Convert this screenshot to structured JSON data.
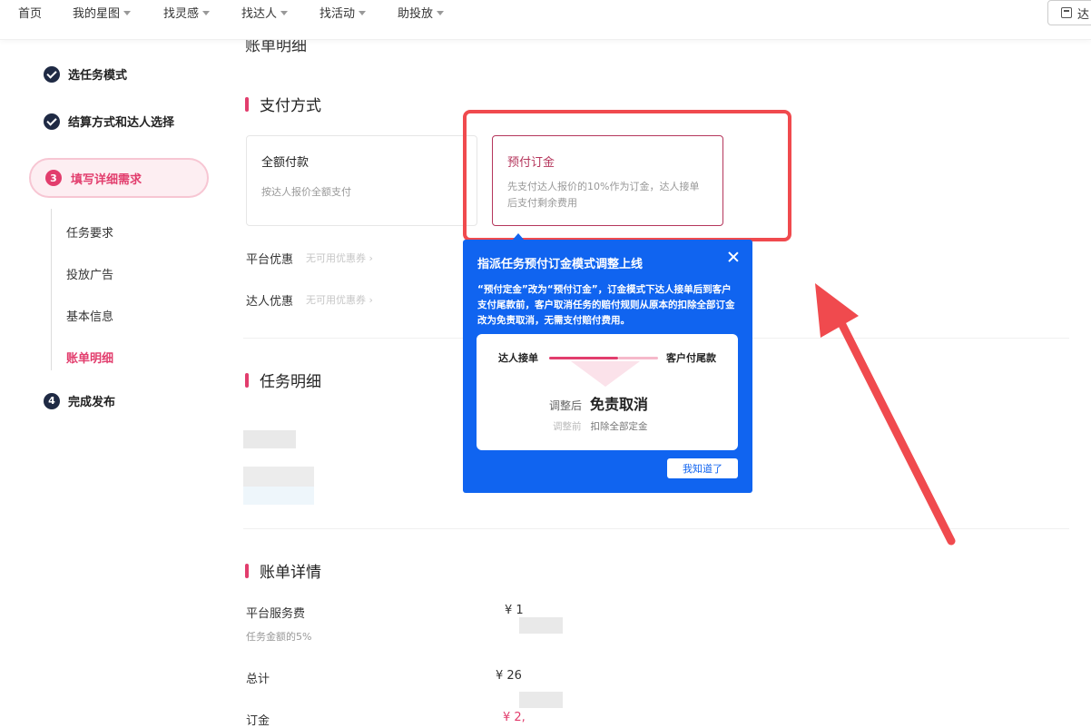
{
  "nav": {
    "items": [
      {
        "label": "首页",
        "dropdown": false
      },
      {
        "label": "我的星图",
        "dropdown": true
      },
      {
        "label": "找灵感",
        "dropdown": true
      },
      {
        "label": "找达人",
        "dropdown": true
      },
      {
        "label": "找活动",
        "dropdown": true
      },
      {
        "label": "助投放",
        "dropdown": true
      }
    ],
    "right_button": "达"
  },
  "sidebar": {
    "steps": {
      "s1": "选任务模式",
      "s2": "结算方式和达人选择",
      "s3_num": "3",
      "s3": "填写详细需求",
      "s4_num": "4",
      "s4": "完成发布"
    },
    "substeps": [
      "任务要求",
      "投放广告",
      "基本信息",
      "账单明细"
    ]
  },
  "main": {
    "clipped_title": "账单明细",
    "payment": {
      "title": "支付方式",
      "full": {
        "name": "全额付款",
        "desc": "按达人报价全额支付"
      },
      "deposit": {
        "name": "预付订金",
        "desc": "先支付达人报价的10%作为订金，达人接单后支付剩余费用"
      }
    },
    "promo": {
      "platform_label": "平台优惠",
      "platform_value": "无可用优惠券 ›",
      "creator_label": "达人优惠",
      "creator_value": "无可用优惠券 ›"
    },
    "task_detail_title": "任务明细",
    "bill": {
      "title": "账单详情",
      "service_fee_label": "平台服务费",
      "service_fee_value": "¥ 1",
      "service_fee_sub": "任务金额的5%",
      "total_label": "总计",
      "total_value": "¥ 26",
      "deposit_label": "订金",
      "deposit_value": "¥ 2,"
    }
  },
  "popover": {
    "title": "指派任务预付订金模式调整上线",
    "body": "“预付定金”改为“预付订金”，订金模式下达人接单后到客户支付尾款前，客户取消任务的赔付规则从原本的扣除全部订金改为免责取消，无需支付赔付费用。",
    "card": {
      "left": "达人接单",
      "right": "客户付尾款",
      "after_label": "调整后",
      "after_value": "免责取消",
      "before_label": "调整前",
      "before_value": "扣除全部定金"
    },
    "button": "我知道了"
  },
  "colors": {
    "accent": "#e23d6d",
    "popover_bg": "#1064f0",
    "highlight": "#f04a4e"
  }
}
